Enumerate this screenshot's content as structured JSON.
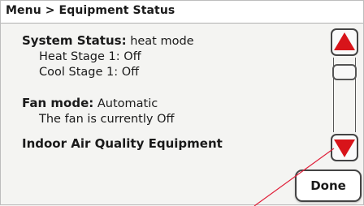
{
  "header": {
    "breadcrumb": "Menu > Equipment Status"
  },
  "system_status": {
    "label": "System Status:",
    "value": "heat mode",
    "heat_stage": "Heat Stage 1: Off",
    "cool_stage": "Cool Stage 1: Off"
  },
  "fan": {
    "label": "Fan mode:",
    "value": "Automatic",
    "status": "The fan is currently Off"
  },
  "iaq": {
    "title": "Indoor Air Quality Equipment"
  },
  "buttons": {
    "done_label": "Done",
    "scroll_up_icon": "red-up-triangle-icon",
    "scroll_down_icon": "red-down-triangle-icon"
  },
  "colors": {
    "arrow_red": "#d8141a",
    "annotation_line": "#e0203a"
  }
}
